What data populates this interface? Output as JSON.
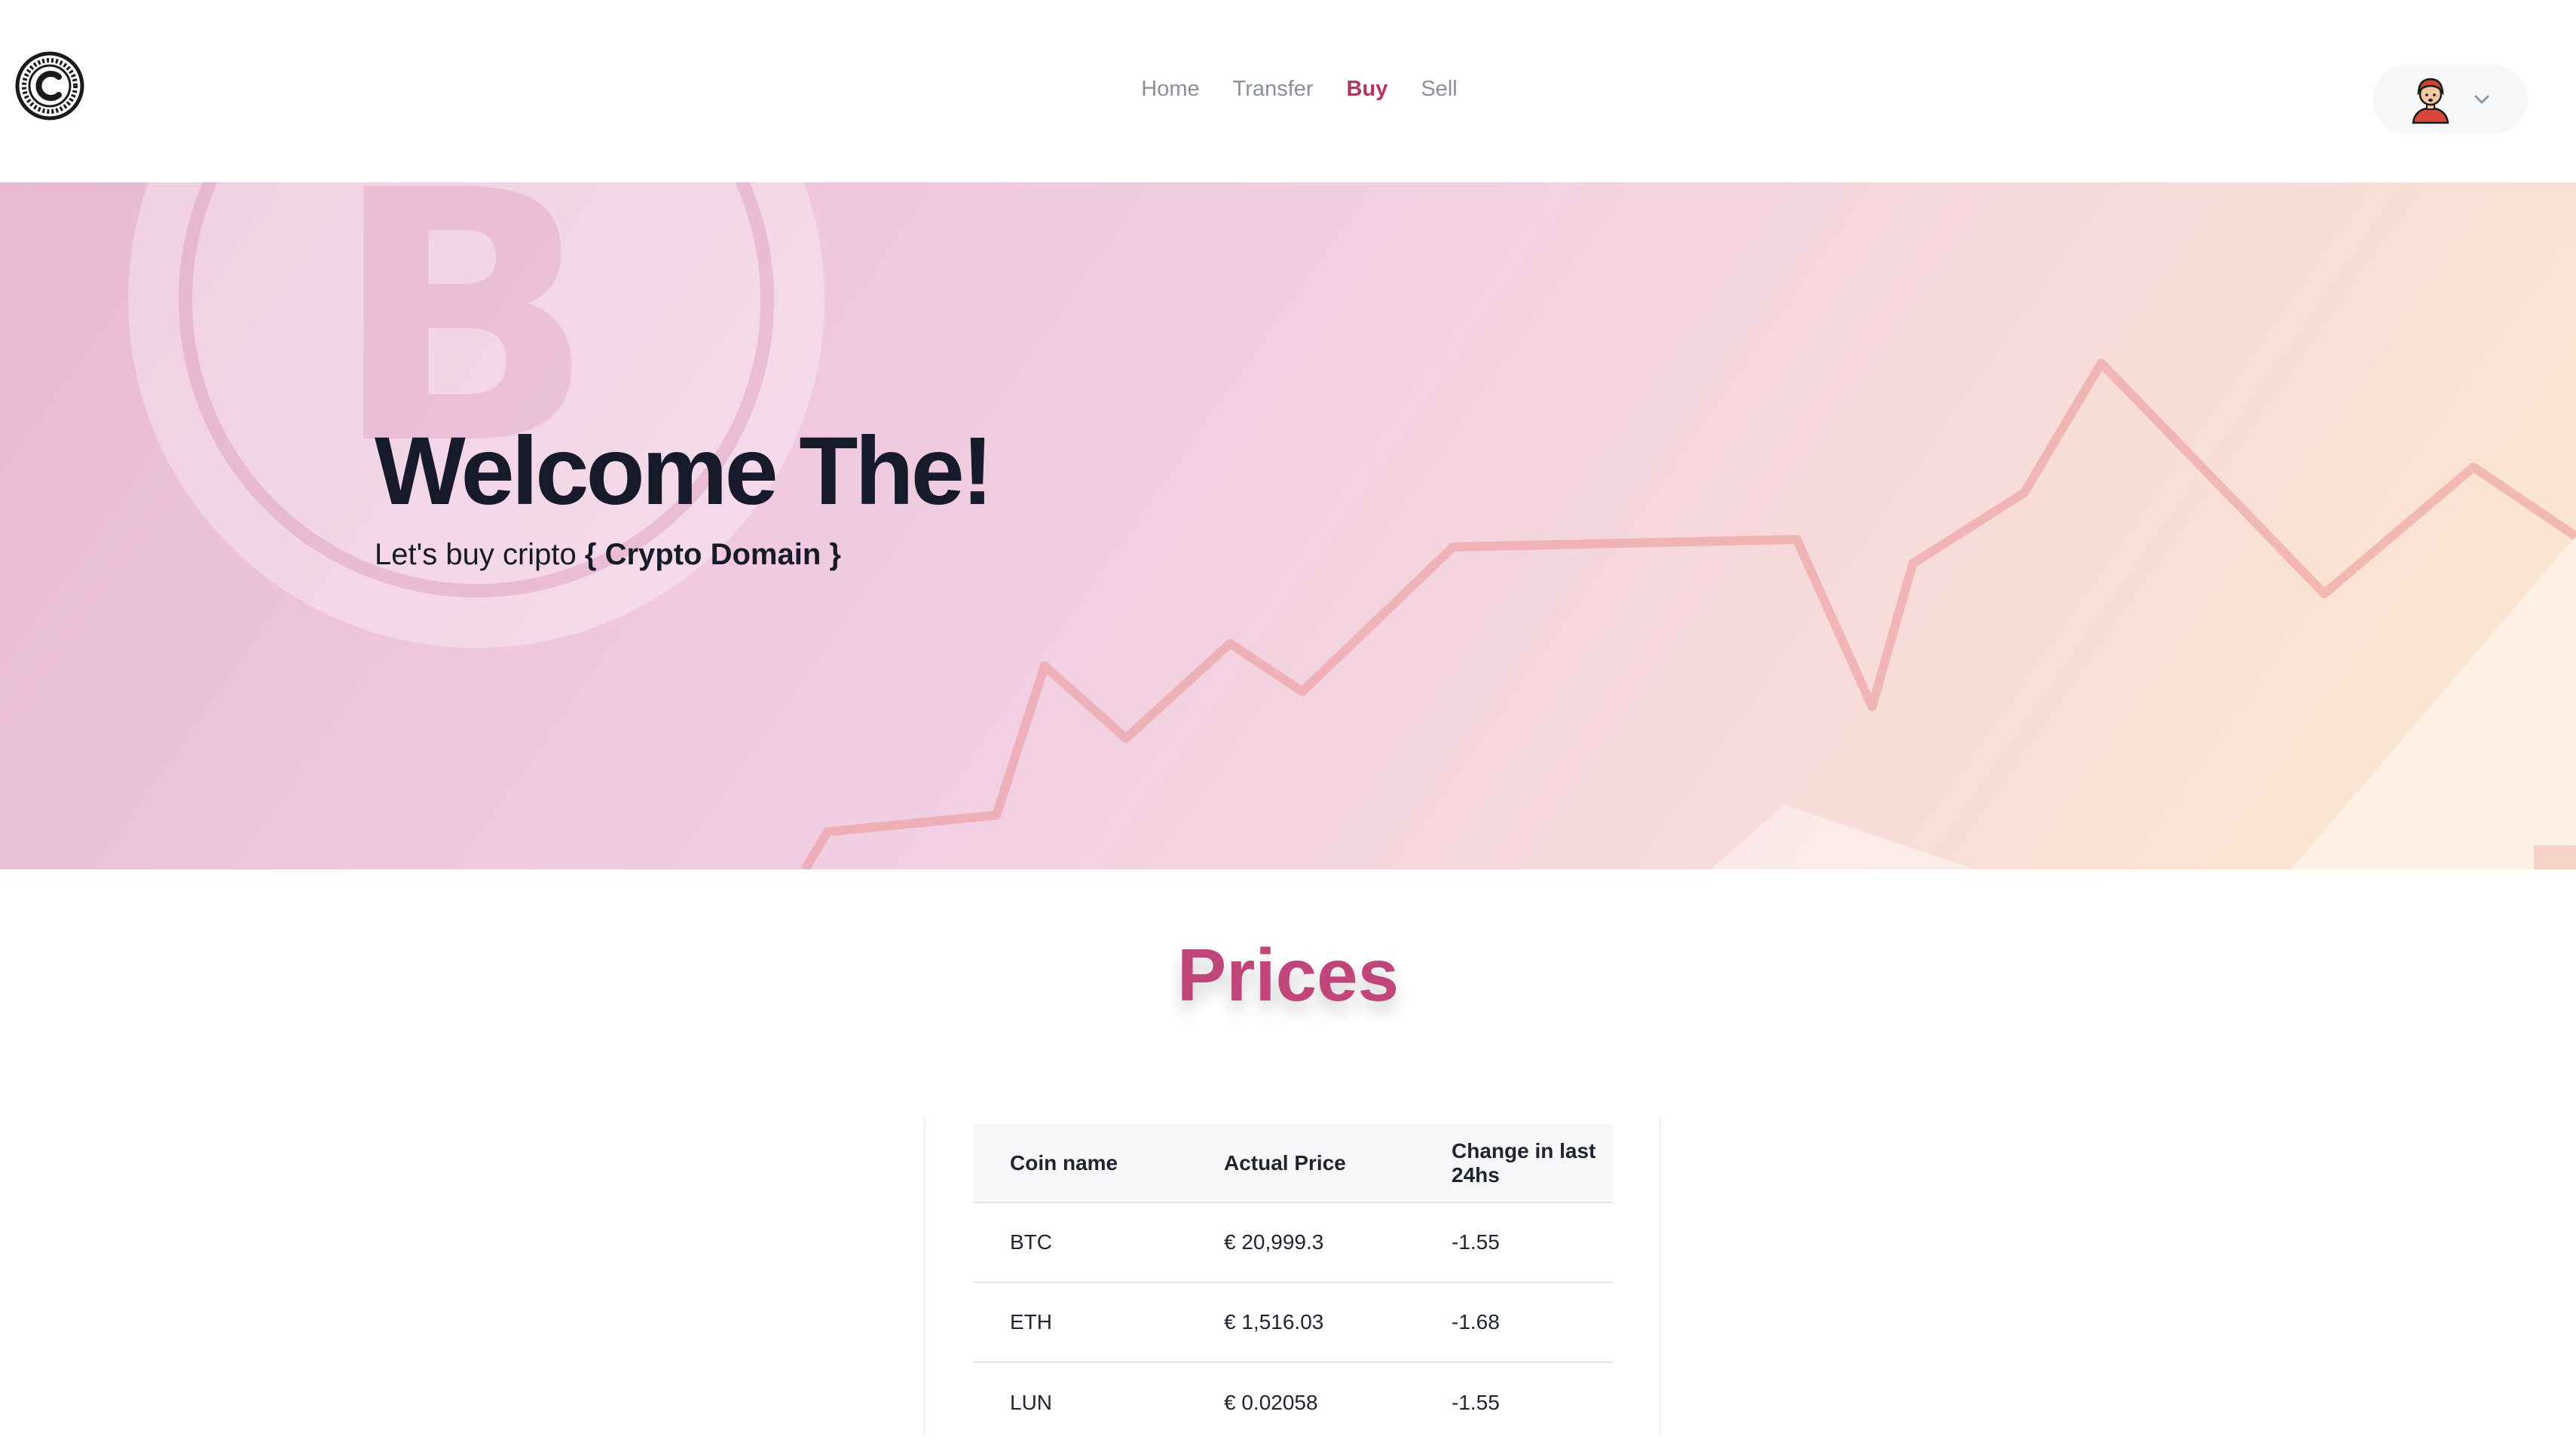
{
  "nav": {
    "items": [
      {
        "label": "Home",
        "active": false
      },
      {
        "label": "Transfer",
        "active": false
      },
      {
        "label": "Buy",
        "active": true
      },
      {
        "label": "Sell",
        "active": false
      }
    ]
  },
  "hero": {
    "title": "Welcome The!",
    "subtitle_prefix": "Let's buy cripto ",
    "subtitle_brand": "{ Crypto Domain }"
  },
  "prices": {
    "title": "Prices",
    "columns": [
      "Coin name",
      "Actual Price",
      "Change in last 24hs"
    ],
    "rows": [
      {
        "coin": "BTC",
        "price": "€ 20,999.3",
        "change": "-1.55"
      },
      {
        "coin": "ETH",
        "price": "€ 1,516.03",
        "change": "-1.68"
      },
      {
        "coin": "LUN",
        "price": "€ 0.02058",
        "change": "-1.55"
      }
    ]
  },
  "colors": {
    "accent": "#b5335f",
    "title": "#161a2b",
    "nav_inactive": "#8a8f98"
  },
  "icons": {
    "logo": "coin-logo-icon",
    "avatar": "user-avatar-icon",
    "menu": "chevron-down-icon"
  }
}
